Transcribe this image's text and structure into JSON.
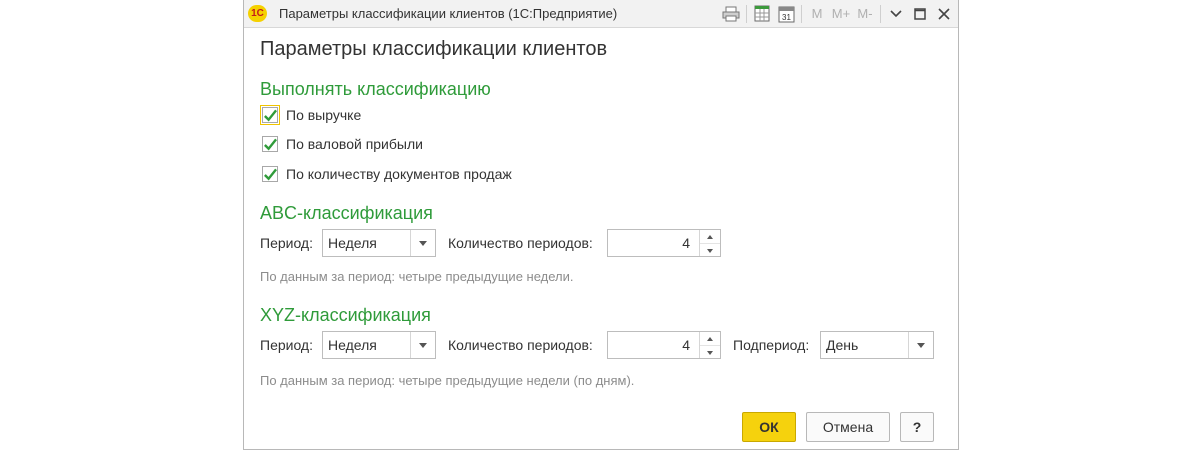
{
  "window": {
    "logo": "1С",
    "title": "Параметры классификации клиентов  (1С:Предприятие)",
    "toolbar": {
      "m_label": "M",
      "m_plus_label": "M+",
      "m_minus_label": "M-",
      "calendar_day": "31"
    }
  },
  "form": {
    "title": "Параметры классификации клиентов",
    "classification": {
      "heading": "Выполнять классификацию",
      "options": [
        {
          "label": "По выручке",
          "checked": true
        },
        {
          "label": "По валовой прибыли",
          "checked": true
        },
        {
          "label": "По количеству документов продаж",
          "checked": true
        }
      ]
    },
    "abc": {
      "heading": "ABC-классификация",
      "period_label": "Период:",
      "period_value": "Неделя",
      "count_label": "Количество периодов:",
      "count_value": "4",
      "hint": "По данным за период: четыре предыдущие недели."
    },
    "xyz": {
      "heading": "XYZ-классификация",
      "period_label": "Период:",
      "period_value": "Неделя",
      "count_label": "Количество периодов:",
      "count_value": "4",
      "subperiod_label": "Подпериод:",
      "subperiod_value": "День",
      "hint": "По данным за период: четыре предыдущие недели (по дням)."
    },
    "buttons": {
      "ok": "ОК",
      "cancel": "Отмена",
      "help": "?"
    }
  },
  "colors": {
    "group_heading": "#2f9b3a",
    "checkmark": "#2f9b3a",
    "ok_button": "#f5d20d",
    "focus_border": "#f0c400"
  }
}
